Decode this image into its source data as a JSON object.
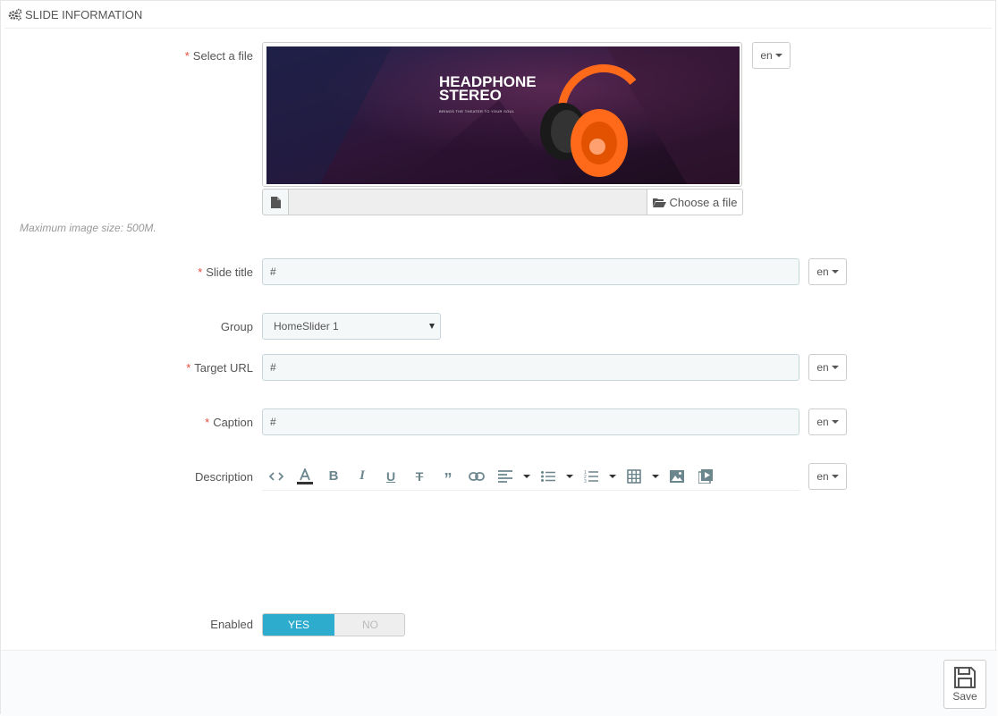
{
  "panel": {
    "title": "SLIDE INFORMATION",
    "title_icon": "cogs-icon"
  },
  "fields": {
    "file": {
      "label": "Select a file",
      "required": "*",
      "lang": "en",
      "choose_label": "Choose a file",
      "help": "Maximum image size: 500M.",
      "preview": {
        "headline_1": "HEADPHONE",
        "headline_2": "STEREO",
        "tagline": "BRINGS THE THEATER TO YOUR SOUL"
      }
    },
    "slide_title": {
      "label": "Slide title",
      "required": "*",
      "value": "#",
      "lang": "en"
    },
    "group": {
      "label": "Group",
      "value": "HomeSlider 1"
    },
    "target_url": {
      "label": "Target URL",
      "required": "*",
      "value": "#",
      "lang": "en"
    },
    "caption": {
      "label": "Caption",
      "required": "*",
      "value": "#",
      "lang": "en"
    },
    "description": {
      "label": "Description",
      "lang": "en",
      "toolbar": [
        "code-view-icon",
        "font-color-icon",
        "bold-icon",
        "italic-icon",
        "underline-icon",
        "strikethrough-icon",
        "blockquote-icon",
        "link-icon",
        "align-icon",
        "unordered-list-icon",
        "ordered-list-icon",
        "table-icon",
        "image-icon",
        "video-icon"
      ]
    },
    "enabled": {
      "label": "Enabled",
      "yes": "YES",
      "no": "NO",
      "value": "YES"
    }
  },
  "footer": {
    "save_label": "Save"
  },
  "colors": {
    "accent": "#2eacce",
    "required": "#e74c3c",
    "product": "#ff6a1a"
  }
}
